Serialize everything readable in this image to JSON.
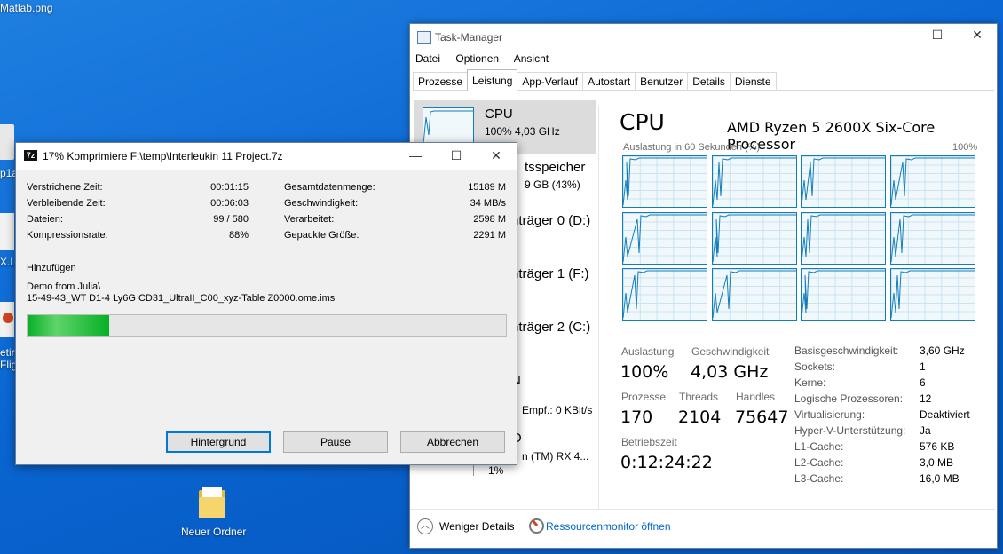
{
  "desktop": {
    "top_file": "Matlab.png",
    "left_labels": [
      "p1a",
      "X.L",
      "etir",
      "Flig"
    ],
    "folder_label": "Neuer Ordner"
  },
  "taskmgr": {
    "title": "Task-Manager",
    "menu": [
      "Datei",
      "Optionen",
      "Ansicht"
    ],
    "tabs": [
      "Prozesse",
      "Leistung",
      "App-Verlauf",
      "Autostart",
      "Benutzer",
      "Details",
      "Dienste"
    ],
    "active_tab": "Leistung",
    "sidebar": [
      {
        "name": "CPU",
        "sub": "100%  4,03 GHz"
      },
      {
        "name": "tsspeicher",
        "sub": "9 GB (43%)"
      },
      {
        "name": "nträger 0 (D:)",
        "sub": ""
      },
      {
        "name": "nträger 1 (F:)",
        "sub": ""
      },
      {
        "name": "nträger 2 (C:)",
        "sub": ""
      },
      {
        "name": "N",
        "sub": "Empf.: 0 KBit/s"
      },
      {
        "name": "O",
        "sub": "n (TM) RX 4...",
        "sub2": "1%"
      }
    ],
    "main": {
      "heading": "CPU",
      "model": "AMD Ryzen 5 2600X Six-Core Processor",
      "graph_caption": "Auslastung in 60 Sekunden (%)",
      "graph_max": "100%",
      "stats": {
        "auslastung_label": "Auslastung",
        "auslastung": "100%",
        "geschw_label": "Geschwindigkeit",
        "geschw": "4,03 GHz",
        "prozesse_label": "Prozesse",
        "prozesse": "170",
        "threads_label": "Threads",
        "threads": "2104",
        "handles_label": "Handles",
        "handles": "75647",
        "betrieb_label": "Betriebszeit",
        "betrieb": "0:12:24:22"
      },
      "info": [
        {
          "k": "Basisgeschwindigkeit:",
          "v": "3,60 GHz"
        },
        {
          "k": "Sockets:",
          "v": "1"
        },
        {
          "k": "Kerne:",
          "v": "6"
        },
        {
          "k": "Logische Prozessoren:",
          "v": "12"
        },
        {
          "k": "Virtualisierung:",
          "v": "Deaktiviert"
        },
        {
          "k": "Hyper-V-Unterstützung:",
          "v": "Ja"
        },
        {
          "k": "L1-Cache:",
          "v": "576 KB"
        },
        {
          "k": "L2-Cache:",
          "v": "3,0 MB"
        },
        {
          "k": "L3-Cache:",
          "v": "16,0 MB"
        }
      ]
    },
    "footer": {
      "less": "Weniger Details",
      "resmon": "Ressourcenmonitor öffnen"
    }
  },
  "dialog": {
    "icon_text": "7z",
    "title": "17% Komprimiere F:\\temp\\Interleukin 11 Project.7z",
    "left": [
      {
        "k": "Verstrichene Zeit:",
        "v": "00:01:15"
      },
      {
        "k": "Verbleibende Zeit:",
        "v": "00:06:03"
      },
      {
        "k": "Dateien:",
        "v": "99 / 580"
      },
      {
        "k": "Kompressionsrate:",
        "v": "88%"
      }
    ],
    "right": [
      {
        "k": "Gesamtdatenmenge:",
        "v": "15189 M"
      },
      {
        "k": "Geschwindigkeit:",
        "v": "34 MB/s"
      },
      {
        "k": "Verarbeitet:",
        "v": "2598 M"
      },
      {
        "k": "Gepackte Größe:",
        "v": "2291 M"
      }
    ],
    "action": "Hinzufügen",
    "path1": "Demo from Julia\\",
    "path2": "15-49-43_WT D1-4 Ly6G CD31_UltraII_C00_xyz-Table Z0000.ome.ims",
    "progress": 0.17,
    "buttons": {
      "bg": "Hintergrund",
      "pause": "Pause",
      "cancel": "Abbrechen"
    }
  },
  "colors": {
    "accent": "#117dbb",
    "progress": "#06b025"
  }
}
